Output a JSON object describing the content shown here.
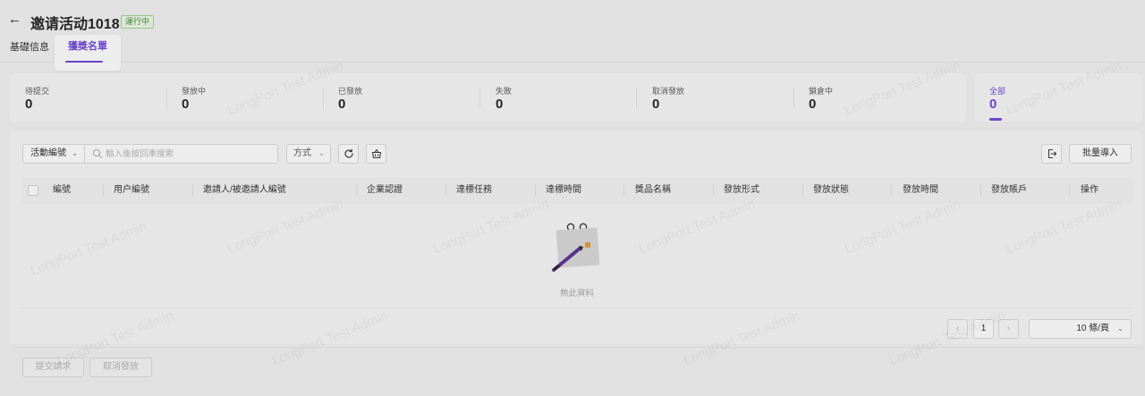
{
  "header": {
    "title": "邀请活动1018",
    "status_badge": "運行中"
  },
  "tabs": [
    {
      "label": "基礎信息",
      "active": false
    },
    {
      "label": "獲獎名單",
      "active": true
    }
  ],
  "summary": {
    "stats": [
      {
        "label": "待提交",
        "value": "0"
      },
      {
        "label": "發放中",
        "value": "0"
      },
      {
        "label": "已發放",
        "value": "0"
      },
      {
        "label": "失敗",
        "value": "0"
      },
      {
        "label": "取消發放",
        "value": "0"
      },
      {
        "label": "鎖倉中",
        "value": "0"
      }
    ],
    "all": {
      "label": "全部",
      "value": "0"
    }
  },
  "toolbar": {
    "filter_field": "活動編號",
    "search_placeholder": "輸入後按回車搜索",
    "method_label": "方式",
    "batch_import_label": "批量導入"
  },
  "table": {
    "columns": [
      "編號",
      "用户編號",
      "邀請人/被邀請人編號",
      "企業認證",
      "達標任務",
      "達標時間",
      "獎品名稱",
      "發放形式",
      "發放狀態",
      "發放時間",
      "發放賬戶",
      "操作"
    ],
    "rows": [],
    "empty_text": "無此資料"
  },
  "pagination": {
    "current_page": "1",
    "prev": "‹",
    "next": "›",
    "page_size": "10 條/頁"
  },
  "footer": {
    "submit_label": "提交請求",
    "cancel_label": "取消發放"
  },
  "watermark": "LongPort Test Admin",
  "colors": {
    "accent": "#6b3fd6",
    "status_green": "#3d8b2f"
  }
}
